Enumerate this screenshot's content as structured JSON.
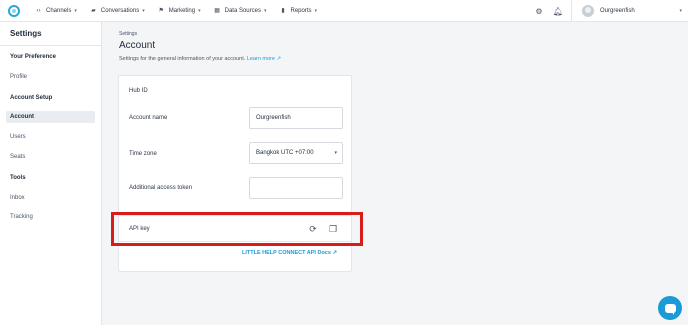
{
  "topnav": {
    "items": [
      {
        "label": "Channels",
        "icon": "channels-icon"
      },
      {
        "label": "Conversations",
        "icon": "conversations-icon"
      },
      {
        "label": "Marketing",
        "icon": "marketing-icon"
      },
      {
        "label": "Data Sources",
        "icon": "data-sources-icon"
      },
      {
        "label": "Reports",
        "icon": "reports-icon"
      }
    ],
    "user_name": "Ourgreenfish"
  },
  "sidebar": {
    "title": "Settings",
    "sections": [
      {
        "label": "Your Preference",
        "items": [
          {
            "label": "Profile"
          }
        ]
      },
      {
        "label": "Account Setup",
        "items": [
          {
            "label": "Account",
            "active": true
          },
          {
            "label": "Users"
          },
          {
            "label": "Seats"
          }
        ]
      },
      {
        "label": "Tools",
        "items": [
          {
            "label": "Inbox"
          },
          {
            "label": "Tracking"
          }
        ]
      }
    ]
  },
  "main": {
    "breadcrumb": "Settings",
    "title": "Account",
    "subtitle": "Settings for the general information of your account.",
    "learn_more": "Learn more",
    "fields": {
      "hub_id_label": "Hub ID",
      "account_name_label": "Account name",
      "account_name_value": "Ourgreenfish",
      "time_zone_label": "Time zone",
      "time_zone_value": "Bangkok UTC +07:00",
      "access_token_label": "Additional access token",
      "access_token_value": "",
      "api_key_label": "API key"
    },
    "docs_link": "LITTLE HELP CONNECT API Docs"
  },
  "colors": {
    "accent": "#1a9ad6",
    "highlight": "#d81b1b"
  }
}
